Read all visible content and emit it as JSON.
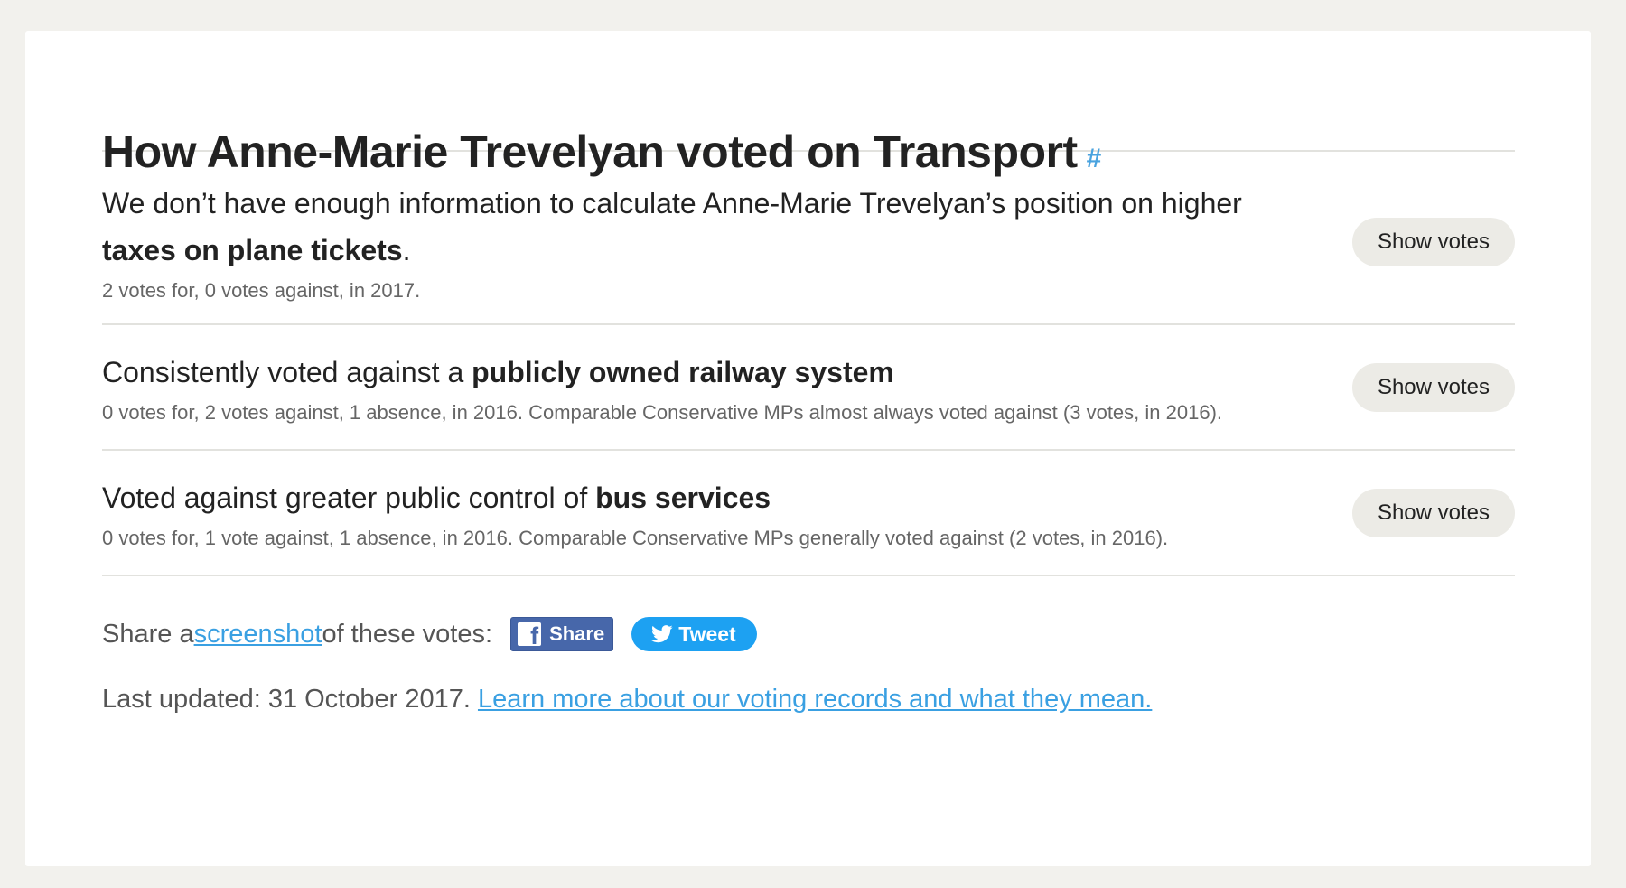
{
  "heading": {
    "title": "How Anne-Marie Trevelyan voted on Transport",
    "anchor": "#"
  },
  "votes": [
    {
      "text_before": "We don’t have enough information to calculate Anne-Marie Trevelyan’s position on higher ",
      "text_bold": "taxes on plane tickets",
      "text_after": ".",
      "summary": "2 votes for, 0 votes against, in 2017.",
      "button": "Show votes"
    },
    {
      "text_before": "Consistently voted against a ",
      "text_bold": "publicly owned railway system",
      "text_after": "",
      "summary": "0 votes for, 2 votes against, 1 absence, in 2016. Comparable Conservative MPs almost always voted against (3 votes, in 2016).",
      "button": "Show votes"
    },
    {
      "text_before": "Voted against greater public control of ",
      "text_bold": "bus services",
      "text_after": "",
      "summary": "0 votes for, 1 vote against, 1 absence, in 2016. Comparable Conservative MPs generally voted against (2 votes, in 2016).",
      "button": "Show votes"
    }
  ],
  "share": {
    "prefix": "Share a ",
    "link": "screenshot",
    "suffix": " of these votes:",
    "facebook_label": "Share",
    "facebook_icon": "facebook-icon",
    "twitter_label": "Tweet",
    "twitter_icon": "twitter-bird-icon",
    "facebook_color": "#4767aa",
    "twitter_color": "#1da1f2"
  },
  "updated": {
    "text": "Last updated: 31 October 2017. ",
    "link": "Learn more about our voting records and what they mean."
  },
  "colors": {
    "page_background": "#f2f1ed",
    "card_background": "#ffffff",
    "link": "#3aa0e2",
    "button_background": "#ecebe6"
  }
}
